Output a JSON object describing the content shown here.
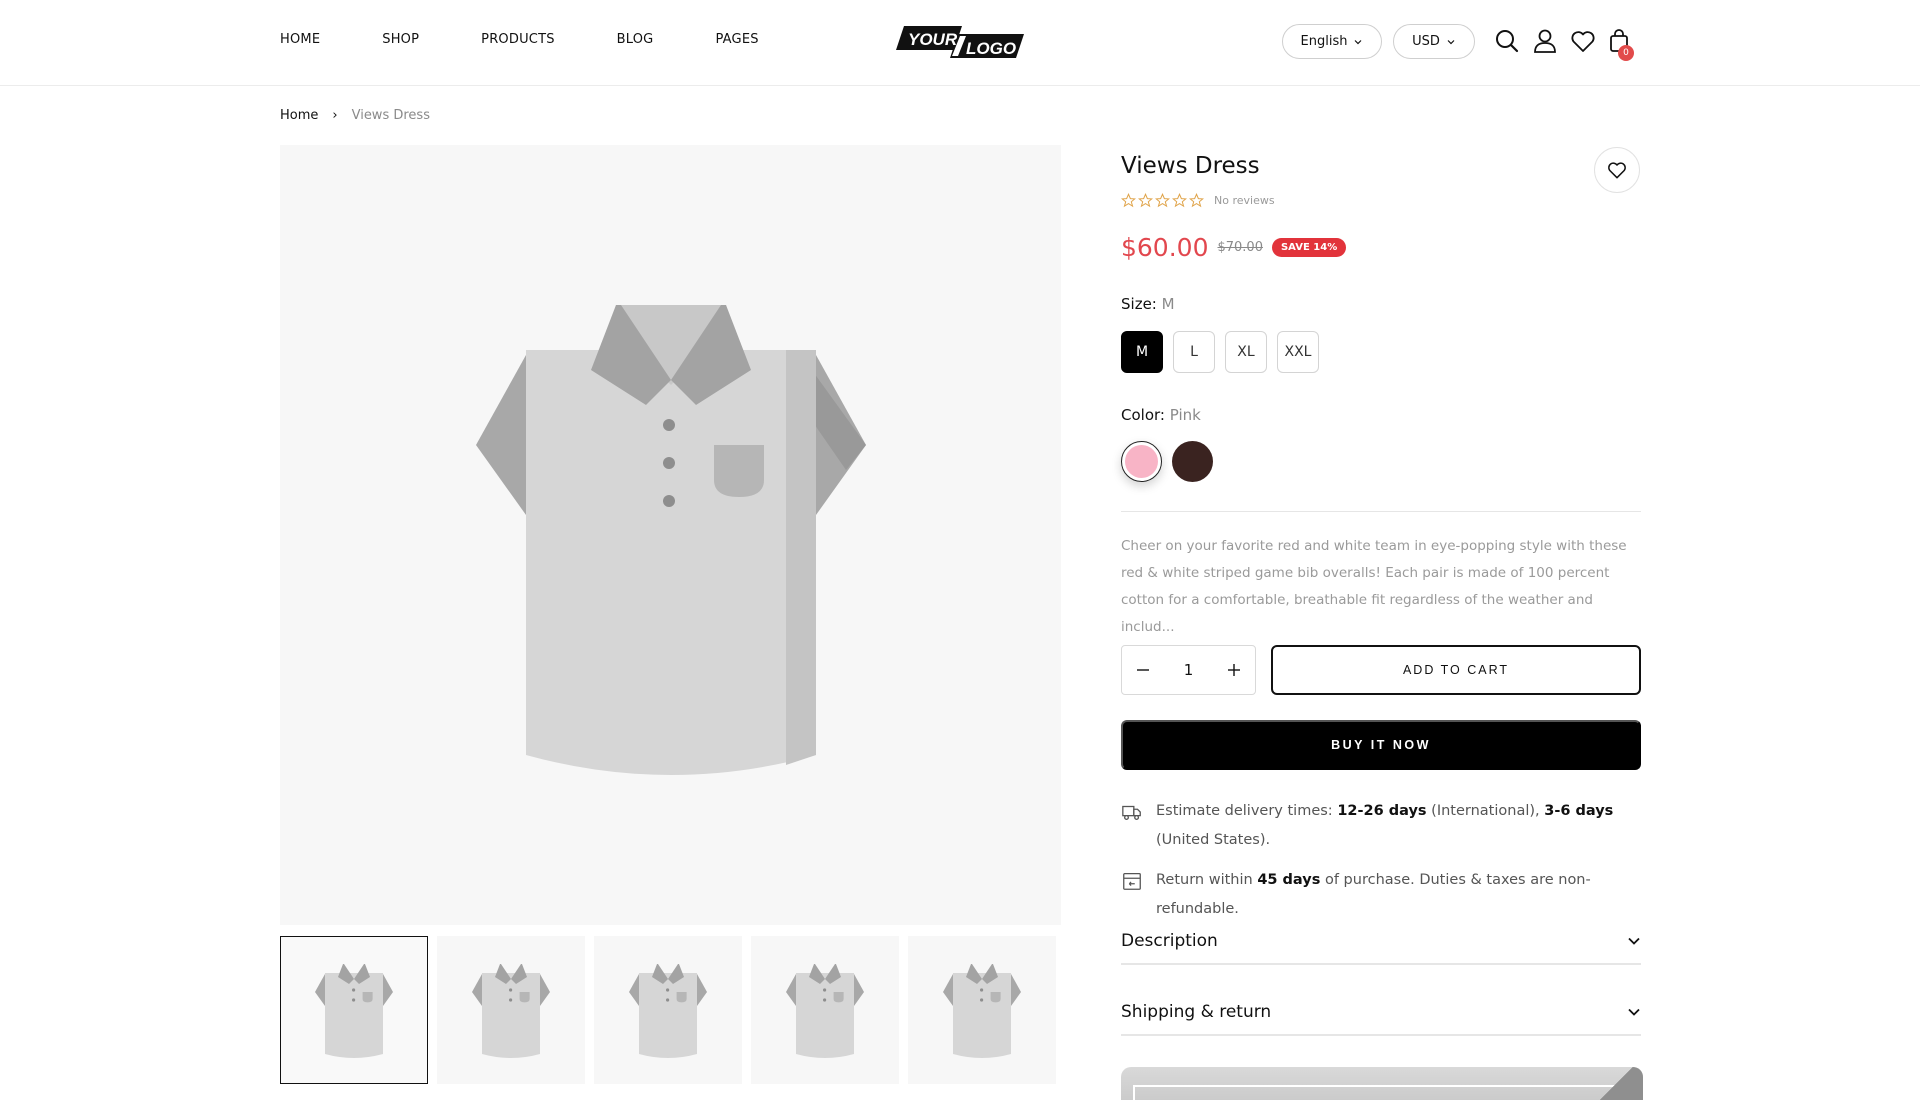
{
  "nav": {
    "items": [
      "HOME",
      "SHOP",
      "PRODUCTS",
      "BLOG",
      "PAGES"
    ]
  },
  "logo": {
    "word1": "YOUR",
    "word2": "LOGO"
  },
  "header": {
    "language": "English",
    "currency": "USD",
    "cart_count": "0"
  },
  "breadcrumb": {
    "home": "Home",
    "separator": "›",
    "current": "Views Dress"
  },
  "gallery": {
    "thumbnail_count": 5
  },
  "product": {
    "title": "Views Dress",
    "rating_stars": 0,
    "reviews_text": "No reviews",
    "price": "$60.00",
    "compare_price": "$70.00",
    "save_badge": "SAVE 14%",
    "size_label": "Size:",
    "size_value": "M",
    "sizes": [
      "M",
      "L",
      "XL",
      "XXL"
    ],
    "color_label": "Color:",
    "color_value": "Pink",
    "colors": [
      {
        "name": "Pink",
        "hex": "#f8b4c6"
      },
      {
        "name": "Dark Brown",
        "hex": "#3a2320"
      }
    ],
    "description": "Cheer on your favorite red and white team in eye-popping style with these red & white striped game bib overalls! Each pair is made of 100 percent cotton for a comfortable, breathable fit regardless of the weather and includ...",
    "quantity": "1",
    "add_to_cart": "ADD TO CART",
    "buy_now": "BUY IT NOW"
  },
  "delivery": {
    "prefix": "Estimate delivery times: ",
    "intl_days": "12-26 days",
    "intl_label": " (International), ",
    "us_days": "3-6 days",
    "us_label": " (United States)."
  },
  "returns": {
    "prefix": "Return within ",
    "days": "45 days",
    "suffix": " of purchase. Duties & taxes are non-refundable."
  },
  "accordions": {
    "description": "Description",
    "shipping": "Shipping & return"
  },
  "colors": {
    "accent_price": "#e2474e",
    "badge_bg": "#e2333b",
    "cart_badge": "#e24b4b",
    "star": "#e0a44a"
  }
}
